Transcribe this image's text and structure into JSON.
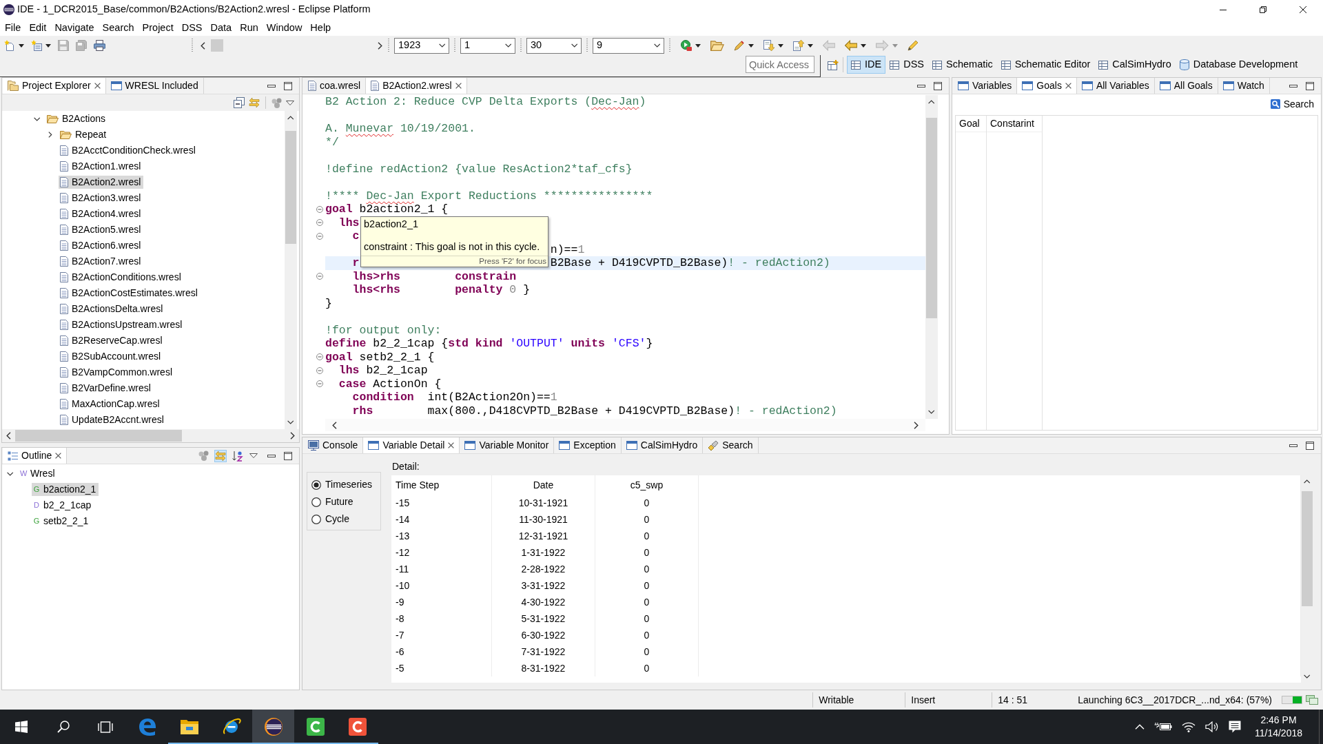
{
  "window": {
    "title": "IDE - 1_DCR2015_Base/common/B2Actions/B2Action2.wresl - Eclipse Platform"
  },
  "menu": [
    "File",
    "Edit",
    "Navigate",
    "Search",
    "Project",
    "DSS",
    "Data",
    "Run",
    "Window",
    "Help"
  ],
  "toolbar": {
    "file_buttons": [
      {
        "kind": "new",
        "disabled": false,
        "dropdown": true
      },
      {
        "kind": "new-project",
        "disabled": false,
        "dropdown": true
      },
      {
        "kind": "save",
        "disabled": true,
        "dropdown": false
      },
      {
        "kind": "save-all",
        "disabled": true,
        "dropdown": false
      },
      {
        "kind": "print",
        "disabled": false,
        "dropdown": false
      }
    ],
    "combos": [
      {
        "value": "1923"
      },
      {
        "value": "1"
      },
      {
        "value": "30"
      },
      {
        "value": "9"
      }
    ],
    "tool_buttons": [
      {
        "kind": "run",
        "disabled": false,
        "dropdown": true
      },
      {
        "kind": "open",
        "disabled": false,
        "dropdown": false
      },
      {
        "kind": "tool",
        "disabled": false,
        "dropdown": true
      },
      {
        "kind": "next",
        "disabled": false,
        "dropdown": true
      },
      {
        "kind": "previous",
        "disabled": false,
        "dropdown": true
      },
      {
        "kind": "last-edit",
        "disabled": true,
        "dropdown": false
      },
      {
        "kind": "back",
        "disabled": false,
        "dropdown": true
      },
      {
        "kind": "forward",
        "disabled": true,
        "dropdown": true
      },
      {
        "kind": "brush",
        "disabled": false,
        "dropdown": false
      }
    ],
    "quick_access": {
      "placeholder": "Quick Access"
    },
    "perspectives": [
      {
        "label": "IDE",
        "kind": "grid",
        "selected": true
      },
      {
        "label": "DSS",
        "kind": "grid",
        "selected": false
      },
      {
        "label": "Schematic",
        "kind": "grid",
        "selected": false
      },
      {
        "label": "Schematic Editor",
        "kind": "grid",
        "selected": false
      },
      {
        "label": "CalSimHydro",
        "kind": "grid",
        "selected": false
      },
      {
        "label": "Database Development",
        "kind": "database",
        "selected": false
      }
    ]
  },
  "project_explorer": {
    "tabs": [
      {
        "label": "Project Explorer",
        "kind": "explorer",
        "selected": true
      },
      {
        "label": "WRESL Included",
        "kind": "view",
        "selected": false
      }
    ],
    "tree": [
      {
        "label": "B2Actions",
        "kind": "folder",
        "expanded": true,
        "selected": false,
        "children": [
          {
            "label": "Repeat",
            "kind": "folder",
            "expanded": false,
            "selected": false
          },
          {
            "label": "B2AcctConditionCheck.wresl",
            "kind": "file",
            "selected": false
          },
          {
            "label": "B2Action1.wresl",
            "kind": "file",
            "selected": false
          },
          {
            "label": "B2Action2.wresl",
            "kind": "file",
            "selected": true
          },
          {
            "label": "B2Action3.wresl",
            "kind": "file",
            "selected": false
          },
          {
            "label": "B2Action4.wresl",
            "kind": "file",
            "selected": false
          },
          {
            "label": "B2Action5.wresl",
            "kind": "file",
            "selected": false
          },
          {
            "label": "B2Action6.wresl",
            "kind": "file",
            "selected": false
          },
          {
            "label": "B2Action7.wresl",
            "kind": "file",
            "selected": false
          },
          {
            "label": "B2ActionConditions.wresl",
            "kind": "file",
            "selected": false
          },
          {
            "label": "B2ActionCostEstimates.wresl",
            "kind": "file",
            "selected": false
          },
          {
            "label": "B2ActionsDelta.wresl",
            "kind": "file",
            "selected": false
          },
          {
            "label": "B2ActionsUpstream.wresl",
            "kind": "file",
            "selected": false
          },
          {
            "label": "B2ReserveCap.wresl",
            "kind": "file",
            "selected": false
          },
          {
            "label": "B2SubAccount.wresl",
            "kind": "file",
            "selected": false
          },
          {
            "label": "B2VampCommon.wresl",
            "kind": "file",
            "selected": false
          },
          {
            "label": "B2VarDefine.wresl",
            "kind": "file",
            "selected": false
          },
          {
            "label": "MaxActionCap.wresl",
            "kind": "file",
            "selected": false
          },
          {
            "label": "UpdateB2Accnt.wresl",
            "kind": "file",
            "selected": false
          }
        ]
      }
    ]
  },
  "outline": {
    "tabs": [
      {
        "label": "Outline",
        "kind": "outline",
        "selected": true
      }
    ],
    "tree": [
      {
        "label": "Wresl",
        "glyph": "W",
        "kind": "root",
        "expanded": true,
        "selected": false,
        "children": [
          {
            "label": "b2action2_1",
            "glyph": "G",
            "kind": "goal",
            "selected": true
          },
          {
            "label": "b2_2_1cap",
            "glyph": "D",
            "kind": "define",
            "selected": false
          },
          {
            "label": "setb2_2_1",
            "glyph": "G",
            "kind": "goal",
            "selected": false
          }
        ]
      }
    ]
  },
  "editor": {
    "tabs": [
      {
        "label": "coa.wresl",
        "kind": "file",
        "selected": false
      },
      {
        "label": "B2Action2.wresl",
        "kind": "file",
        "selected": true
      }
    ],
    "lines": [
      {
        "segments": [
          [
            {
              "text": "B2 Action 2: Reduce CVP Delta Exports (",
              "kind": "comment"
            },
            {
              "text": "Dec-Jan",
              "kind": "comment",
              "misspelled": true
            },
            {
              "text": ")",
              "kind": "comment"
            }
          ]
        ],
        "fold": false
      },
      {
        "fold": false
      },
      {
        "segments": [
          [
            {
              "text": "A. ",
              "kind": "comment"
            },
            {
              "text": "Munevar",
              "kind": "comment",
              "misspelled": true
            },
            {
              "text": " 10/19/2001.",
              "kind": "comment"
            }
          ]
        ],
        "fold": false
      },
      {
        "segments": [
          [
            {
              "text": "*/",
              "kind": "comment"
            }
          ]
        ],
        "fold": false
      },
      {
        "fold": false
      },
      {
        "segments": [
          [
            {
              "text": "!define redAction2 {value ResAction2*taf_cfs}",
              "kind": "comment"
            }
          ]
        ],
        "fold": false
      },
      {
        "fold": false
      },
      {
        "segments": [
          [
            {
              "text": "!**** ",
              "kind": "comment"
            },
            {
              "text": "Dec-Jan",
              "kind": "comment",
              "misspelled": true
            },
            {
              "text": " Export Reductions ****************",
              "kind": "comment"
            }
          ]
        ],
        "fold": false
      },
      {
        "segments": [
          [
            {
              "text": "goal",
              "kind": "keyword"
            },
            {
              "text": " b2action2_1 {",
              "kind": "plain"
            }
          ]
        ],
        "fold": true
      },
      {
        "segments": [
          [
            {
              "text": "  lhs",
              "kind": "keyword"
            }
          ]
        ],
        "fold": true
      },
      {
        "segments": [
          [
            {
              "text": "    c",
              "kind": "keyword"
            }
          ]
        ],
        "fold": true
      },
      {
        "segments": [
          [
            {
              "text": "                                 n)==",
              "kind": "plain"
            },
            {
              "text": "1",
              "kind": "number"
            }
          ]
        ],
        "fold": false
      },
      {
        "segments": [
          [
            {
              "text": "    r",
              "kind": "keyword"
            }
          ],
          [
            {
              "text": "                            B2Base + D419CVPTD_B2Base)",
              "kind": "plain"
            },
            {
              "text": "! - redAction2)",
              "kind": "comment"
            }
          ]
        ],
        "fold": false,
        "current": true
      },
      {
        "segments": [
          [
            {
              "text": "    lhs>rhs",
              "kind": "keyword"
            },
            {
              "text": "        constrain",
              "kind": "keyword"
            }
          ]
        ],
        "fold": true
      },
      {
        "segments": [
          [
            {
              "text": "    lhs<rhs",
              "kind": "keyword"
            },
            {
              "text": "        penalty",
              "kind": "keyword"
            },
            {
              "text": " 0",
              "kind": "number"
            },
            {
              "text": " }",
              "kind": "plain"
            }
          ]
        ],
        "fold": false
      },
      {
        "segments": [
          [
            {
              "text": "}",
              "kind": "plain"
            }
          ]
        ],
        "fold": false
      },
      {
        "fold": false
      },
      {
        "segments": [
          [
            {
              "text": "!for output only:",
              "kind": "comment"
            }
          ]
        ],
        "fold": false
      },
      {
        "segments": [
          [
            {
              "text": "define",
              "kind": "keyword"
            },
            {
              "text": " b2_2_1cap {",
              "kind": "plain"
            },
            {
              "text": "std",
              "kind": "keyword"
            },
            {
              "text": " kind",
              "kind": "keyword"
            },
            {
              "text": " 'OUTPUT'",
              "kind": "string"
            },
            {
              "text": " units",
              "kind": "keyword"
            },
            {
              "text": " 'CFS'",
              "kind": "string"
            },
            {
              "text": "}",
              "kind": "plain"
            }
          ]
        ],
        "fold": false
      },
      {
        "segments": [
          [
            {
              "text": "goal",
              "kind": "keyword"
            },
            {
              "text": " setb2_2_1 {",
              "kind": "plain"
            }
          ]
        ],
        "fold": true
      },
      {
        "segments": [
          [
            {
              "text": "  lhs",
              "kind": "keyword"
            },
            {
              "text": " b2_2_1cap",
              "kind": "plain"
            }
          ]
        ],
        "fold": true
      },
      {
        "segments": [
          [
            {
              "text": "  case",
              "kind": "keyword"
            },
            {
              "text": " ActionOn {",
              "kind": "plain"
            }
          ]
        ],
        "fold": true
      },
      {
        "segments": [
          [
            {
              "text": "    condition",
              "kind": "keyword"
            },
            {
              "text": "  int(B2Action2On)==",
              "kind": "plain"
            },
            {
              "text": "1",
              "kind": "number"
            }
          ]
        ],
        "fold": false
      },
      {
        "segments": [
          [
            {
              "text": "    rhs",
              "kind": "keyword"
            },
            {
              "text": "        max(800.,D418CVPTD_B2Base + D419CVPTD_B2Base)",
              "kind": "plain"
            },
            {
              "text": "! - redAction2)",
              "kind": "comment"
            }
          ]
        ],
        "fold": false
      }
    ],
    "tooltip": {
      "title": "b2action2_1",
      "text": "constraint : This goal is not in this cycle.",
      "hint": "Press 'F2' for focus"
    }
  },
  "goals_view": {
    "tabs": [
      {
        "label": "Variables",
        "kind": "view",
        "selected": false
      },
      {
        "label": "Goals",
        "kind": "view",
        "selected": true
      },
      {
        "label": "All Variables",
        "kind": "view",
        "selected": false
      },
      {
        "label": "All Goals",
        "kind": "view",
        "selected": false
      },
      {
        "label": "Watch",
        "kind": "view",
        "selected": false
      }
    ],
    "search_button": {
      "label": "Search"
    },
    "table": {
      "columns": [
        "Goal",
        "Constarint"
      ]
    }
  },
  "bottom_panel": {
    "tabs": [
      {
        "label": "Console",
        "kind": "console",
        "selected": false
      },
      {
        "label": "Variable Detail",
        "kind": "view",
        "selected": true
      },
      {
        "label": "Variable Monitor",
        "kind": "view",
        "selected": false
      },
      {
        "label": "Exception",
        "kind": "view",
        "selected": false
      },
      {
        "label": "CalSimHydro",
        "kind": "view",
        "selected": false
      },
      {
        "label": "Search",
        "kind": "search",
        "selected": false
      }
    ],
    "modes": [
      {
        "label": "Timeseries",
        "selected": true
      },
      {
        "label": "Future",
        "selected": false
      },
      {
        "label": "Cycle",
        "selected": false
      }
    ],
    "detail_label": "Detail:",
    "table": {
      "columns": [
        "Time Step",
        "Date",
        "c5_swp"
      ],
      "rows": [
        [
          "-15",
          "10-31-1921",
          "0"
        ],
        [
          "-14",
          "11-30-1921",
          "0"
        ],
        [
          "-13",
          "12-31-1921",
          "0"
        ],
        [
          "-12",
          "1-31-1922",
          "0"
        ],
        [
          "-11",
          "2-28-1922",
          "0"
        ],
        [
          "-10",
          "3-31-1922",
          "0"
        ],
        [
          "-9",
          "4-30-1922",
          "0"
        ],
        [
          "-8",
          "5-31-1922",
          "0"
        ],
        [
          "-7",
          "6-30-1922",
          "0"
        ],
        [
          "-6",
          "7-31-1922",
          "0"
        ],
        [
          "-5",
          "8-31-1922",
          "0"
        ]
      ]
    }
  },
  "status_bar": {
    "fields": [
      "Writable",
      "Insert",
      "14 : 51"
    ],
    "task": "Launching 6C3__2017DCR_...nd_x64: (57%)",
    "progress": {
      "level": 0.45
    }
  },
  "taskbar": {
    "apps": [
      {
        "kind": "edge",
        "running": false,
        "selected": false
      },
      {
        "kind": "explorer",
        "running": true,
        "selected": false
      },
      {
        "kind": "ie",
        "running": true,
        "selected": false
      },
      {
        "kind": "eclipse",
        "running": true,
        "selected": true
      },
      {
        "kind": "recorder",
        "running": true,
        "selected": false
      },
      {
        "kind": "studio",
        "running": true,
        "selected": false
      }
    ],
    "clock": {
      "time": "2:46 PM",
      "date": "11/14/2018"
    }
  }
}
